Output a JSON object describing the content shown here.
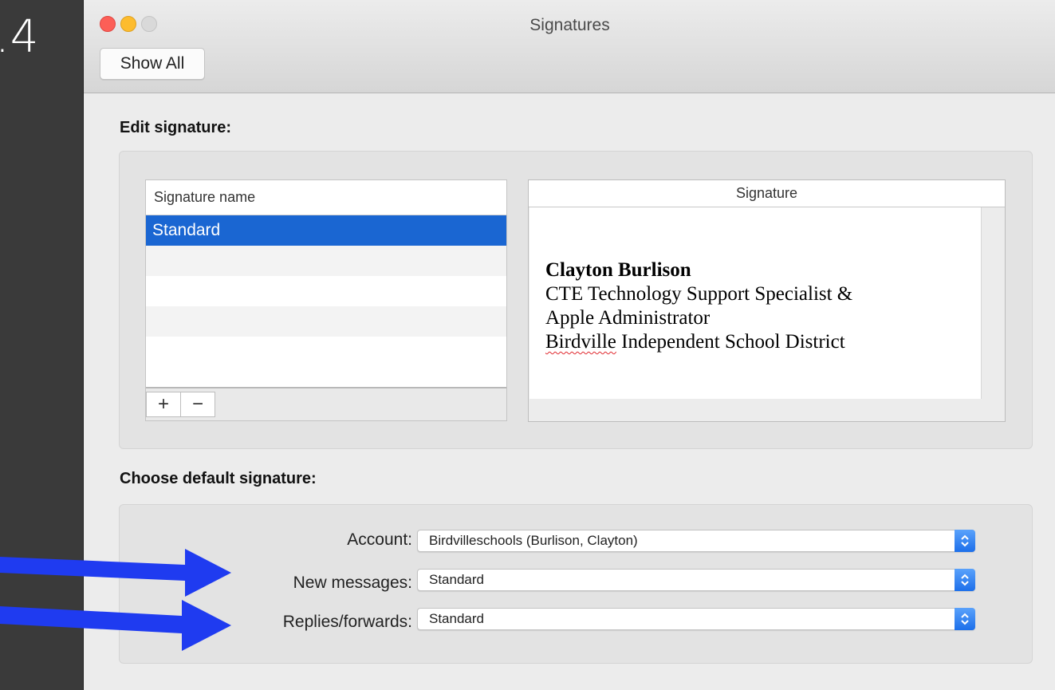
{
  "slide": {
    "step_number": ".4"
  },
  "window": {
    "title": "Signatures",
    "show_all_label": "Show All"
  },
  "edit_section": {
    "label": "Edit signature:",
    "names_header": "Signature name",
    "signatures": [
      "Standard"
    ],
    "add_label": "+",
    "remove_label": "−",
    "signature_header": "Signature",
    "signature_lines": {
      "name": "Clayton Burlison",
      "title1": "CTE Technology Support Specialist &",
      "title2": "Apple Administrator",
      "org_first": "Birdville",
      "org_rest": " Independent School District"
    }
  },
  "default_section": {
    "label": "Choose default signature:",
    "account_label": "Account:",
    "account_value": "Birdvilleschools (Burlison, Clayton)",
    "new_messages_label": "New messages:",
    "new_messages_value": "Standard",
    "replies_label": "Replies/forwards:",
    "replies_value": "Standard"
  },
  "colors": {
    "selection": "#1a66d2",
    "annotation_arrow": "#1f3bf0"
  }
}
